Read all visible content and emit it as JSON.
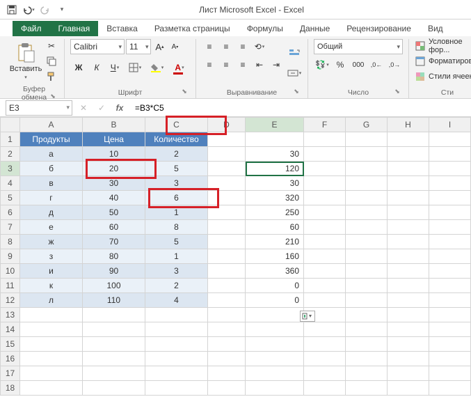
{
  "app": {
    "title": "Лист Microsoft Excel - Excel"
  },
  "qat": {
    "save": "save",
    "undo": "undo",
    "redo": "redo"
  },
  "tabs": {
    "file": "Файл",
    "home": "Главная",
    "insert": "Вставка",
    "layout": "Разметка страницы",
    "formulas": "Формулы",
    "data": "Данные",
    "review": "Рецензирование",
    "view": "Вид"
  },
  "ribbon": {
    "clipboard": {
      "paste": "Вставить",
      "label": "Буфер обмена"
    },
    "font": {
      "name": "Calibri",
      "size": "11",
      "label": "Шрифт"
    },
    "align": {
      "wrap": "Перенести текст",
      "merge": "Объединить",
      "label": "Выравнивание"
    },
    "number": {
      "format": "Общий",
      "label": "Число"
    },
    "styles": {
      "cond": "Условное фор...",
      "fmt": "Форматироват...",
      "cell": "Стили ячеек",
      "label": "Сти"
    }
  },
  "formula_bar": {
    "cell": "E3",
    "formula": "=B3*C5"
  },
  "chart_data": {
    "type": "table",
    "columns": [
      "A",
      "B",
      "C",
      "D",
      "E",
      "F",
      "G",
      "H",
      "I"
    ],
    "headers": {
      "A": "Продукты",
      "B": "Цена",
      "C": "Количество"
    },
    "rows": [
      {
        "n": "1",
        "A": "Продукты",
        "B": "Цена",
        "C": "Количество",
        "E": ""
      },
      {
        "n": "2",
        "A": "а",
        "B": "10",
        "C": "2",
        "E": "30"
      },
      {
        "n": "3",
        "A": "б",
        "B": "20",
        "C": "5",
        "E": "120"
      },
      {
        "n": "4",
        "A": "в",
        "B": "30",
        "C": "3",
        "E": "30"
      },
      {
        "n": "5",
        "A": "г",
        "B": "40",
        "C": "6",
        "E": "320"
      },
      {
        "n": "6",
        "A": "д",
        "B": "50",
        "C": "1",
        "E": "250"
      },
      {
        "n": "7",
        "A": "е",
        "B": "60",
        "C": "8",
        "E": "60"
      },
      {
        "n": "8",
        "A": "ж",
        "B": "70",
        "C": "5",
        "E": "210"
      },
      {
        "n": "9",
        "A": "з",
        "B": "80",
        "C": "1",
        "E": "160"
      },
      {
        "n": "10",
        "A": "и",
        "B": "90",
        "C": "3",
        "E": "360"
      },
      {
        "n": "11",
        "A": "к",
        "B": "100",
        "C": "2",
        "E": "0"
      },
      {
        "n": "12",
        "A": "л",
        "B": "110",
        "C": "4",
        "E": "0"
      },
      {
        "n": "13"
      },
      {
        "n": "14"
      },
      {
        "n": "15"
      },
      {
        "n": "16"
      },
      {
        "n": "17"
      },
      {
        "n": "18"
      }
    ],
    "active_cell": "E3",
    "highlights": [
      "formula_bar",
      "B3",
      "C5"
    ]
  }
}
